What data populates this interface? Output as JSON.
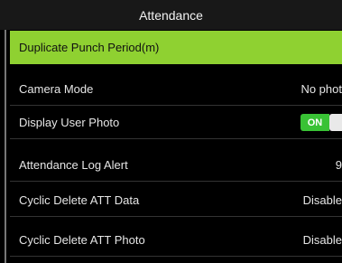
{
  "header": {
    "title": "Attendance"
  },
  "menu": [
    {
      "label": "Duplicate Punch Period(m)",
      "value": ""
    },
    {
      "label": "Camera Mode",
      "value": "No phot"
    },
    {
      "label": "Display User Photo",
      "toggle_label": "ON",
      "toggle_state": "on"
    },
    {
      "label": "Attendance Log Alert",
      "value": "9"
    },
    {
      "label": "Cyclic Delete ATT Data",
      "value": "Disable"
    },
    {
      "label": "Cyclic Delete ATT Photo",
      "value": "Disable"
    }
  ],
  "colors": {
    "selected_row": "#8fd131",
    "toggle_on": "#39c235",
    "background": "#000000"
  }
}
